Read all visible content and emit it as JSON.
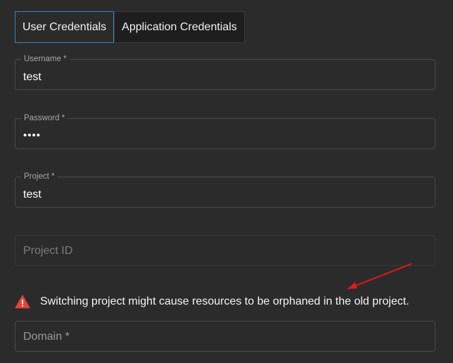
{
  "tabs": [
    {
      "label": "User Credentials",
      "active": true
    },
    {
      "label": "Application Credentials",
      "active": false
    }
  ],
  "fields": {
    "username": {
      "label": "Username *",
      "value": "test"
    },
    "password": {
      "label": "Password *",
      "value": "••••"
    },
    "project": {
      "label": "Project *",
      "value": "test"
    },
    "project_id": {
      "placeholder": "Project ID"
    },
    "domain": {
      "placeholder": "Domain *"
    }
  },
  "warning": {
    "text": "Switching project might cause resources to be orphaned in the old project.",
    "icon": "warning-triangle-icon"
  },
  "colors": {
    "background": "#2b2b2b",
    "active_tab_border": "#2f86c9",
    "warning_icon": "#e0453a",
    "annotation_arrow": "#e5161c"
  }
}
